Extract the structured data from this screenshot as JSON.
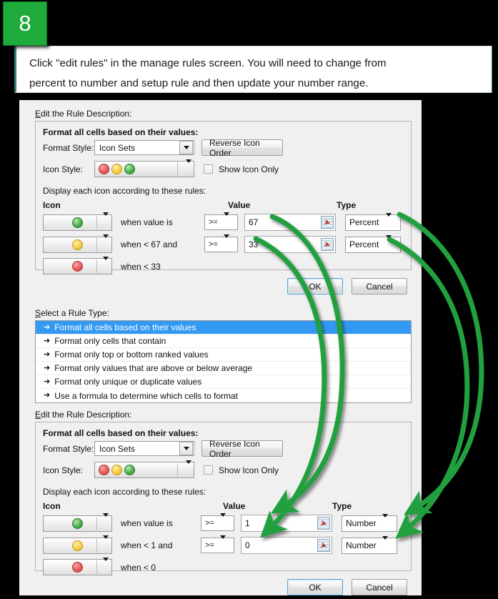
{
  "step": {
    "number": "8"
  },
  "callout": {
    "line1": "Click \"edit rules\" in the manage rules screen. You will need to change from",
    "line2": "percent to number and setup rule and then update your number range."
  },
  "colors": {
    "accent_green": "#1faa3c",
    "arrow_green": "#21a03f",
    "selection_blue": "#3399f3",
    "icon_red": "#e85a5a",
    "icon_yellow": "#f5ce49",
    "icon_green": "#4caf50"
  },
  "top_rule_editor": {
    "section_label": "Edit the Rule Description:",
    "group_title": "Format all cells based on their values:",
    "format_style_label": "Format Style:",
    "format_style_value": "Icon Sets",
    "reverse_icon_order_label": "Reverse Icon Order",
    "icon_style_label": "Icon Style:",
    "show_icon_only_label": "Show Icon Only",
    "display_rules_label": "Display each icon according to these rules:",
    "col_icon": "Icon",
    "col_value": "Value",
    "col_type": "Type",
    "rows": [
      {
        "icon": "green",
        "condition": "when value is",
        "operator": ">=",
        "value": "67",
        "type": "Percent"
      },
      {
        "icon": "yellow",
        "condition": "when < 67 and",
        "operator": ">=",
        "value": "33",
        "type": "Percent"
      },
      {
        "icon": "red",
        "condition": "when < 33",
        "operator": "",
        "value": "",
        "type": ""
      }
    ],
    "ok_label": "OK",
    "cancel_label": "Cancel"
  },
  "rule_type": {
    "section_label": "Select a Rule Type:",
    "items": [
      {
        "label": "Format all cells based on their values",
        "selected": true
      },
      {
        "label": "Format only cells that contain",
        "selected": false
      },
      {
        "label": "Format only top or bottom ranked values",
        "selected": false
      },
      {
        "label": "Format only values that are above or below average",
        "selected": false
      },
      {
        "label": "Format only unique or duplicate values",
        "selected": false
      },
      {
        "label": "Use a formula to determine which cells to format",
        "selected": false
      }
    ]
  },
  "bottom_rule_editor": {
    "section_label": "Edit the Rule Description:",
    "group_title": "Format all cells based on their values:",
    "format_style_label": "Format Style:",
    "format_style_value": "Icon Sets",
    "reverse_icon_order_label": "Reverse Icon Order",
    "icon_style_label": "Icon Style:",
    "show_icon_only_label": "Show Icon Only",
    "display_rules_label": "Display each icon according to these rules:",
    "col_icon": "Icon",
    "col_value": "Value",
    "col_type": "Type",
    "rows": [
      {
        "icon": "green",
        "condition": "when value is",
        "operator": ">=",
        "value": "1",
        "type": "Number"
      },
      {
        "icon": "yellow",
        "condition": "when < 1 and",
        "operator": ">=",
        "value": "0",
        "type": "Number"
      },
      {
        "icon": "red",
        "condition": "when < 0",
        "operator": "",
        "value": "",
        "type": ""
      }
    ],
    "ok_label": "OK",
    "cancel_label": "Cancel"
  },
  "annotations": {
    "arrow_count": 4,
    "arrows": [
      {
        "from": "top-value-67",
        "to": "bottom-value-1"
      },
      {
        "from": "top-value-33",
        "to": "bottom-value-0"
      },
      {
        "from": "top-type-percent-1",
        "to": "bottom-type-number-1"
      },
      {
        "from": "top-type-percent-2",
        "to": "bottom-type-number-2"
      }
    ]
  }
}
